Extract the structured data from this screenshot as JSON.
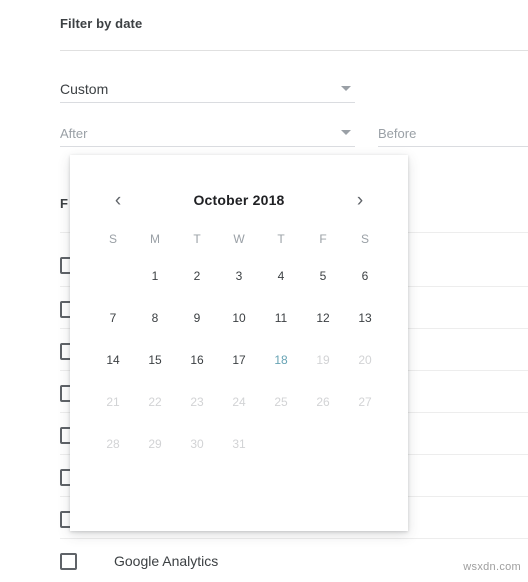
{
  "panel": {
    "section_title": "Filter by date",
    "range_field": {
      "label": "Custom",
      "caret_icon": "chevron-down-icon"
    },
    "after_field": {
      "placeholder": "After",
      "value": "",
      "caret_icon": "chevron-down-icon"
    },
    "before_field": {
      "placeholder": "Before",
      "value": ""
    },
    "obscured_label": "F",
    "checkbox_rows": [
      {
        "label": "",
        "checked": false
      },
      {
        "label": "",
        "checked": false
      },
      {
        "label": "",
        "checked": false
      },
      {
        "label": "",
        "checked": false
      },
      {
        "label": "",
        "checked": false
      },
      {
        "label": "Google Analytics",
        "checked": false
      }
    ]
  },
  "calendar": {
    "prev_icon": "‹",
    "next_icon": "›",
    "prev_label": "previous-month",
    "next_label": "next-month",
    "title": "October 2018",
    "month": "October",
    "year": "2018",
    "day_initials": [
      "S",
      "M",
      "T",
      "W",
      "T",
      "F",
      "S"
    ],
    "today": 18,
    "first_day_column": 1,
    "days_in_month": 31,
    "enabled_through": 18,
    "accent_today": "#67a3b4",
    "weeks": [
      [
        {
          "n": "",
          "state": "empty"
        },
        {
          "n": "1",
          "state": "enabled"
        },
        {
          "n": "2",
          "state": "enabled"
        },
        {
          "n": "3",
          "state": "enabled"
        },
        {
          "n": "4",
          "state": "enabled"
        },
        {
          "n": "5",
          "state": "enabled"
        },
        {
          "n": "6",
          "state": "enabled"
        }
      ],
      [
        {
          "n": "7",
          "state": "enabled"
        },
        {
          "n": "8",
          "state": "enabled"
        },
        {
          "n": "9",
          "state": "enabled"
        },
        {
          "n": "10",
          "state": "enabled"
        },
        {
          "n": "11",
          "state": "enabled"
        },
        {
          "n": "12",
          "state": "enabled"
        },
        {
          "n": "13",
          "state": "enabled"
        }
      ],
      [
        {
          "n": "14",
          "state": "enabled"
        },
        {
          "n": "15",
          "state": "enabled"
        },
        {
          "n": "16",
          "state": "enabled"
        },
        {
          "n": "17",
          "state": "enabled"
        },
        {
          "n": "18",
          "state": "today"
        },
        {
          "n": "19",
          "state": "disabled"
        },
        {
          "n": "20",
          "state": "disabled"
        }
      ],
      [
        {
          "n": "21",
          "state": "disabled"
        },
        {
          "n": "22",
          "state": "disabled"
        },
        {
          "n": "23",
          "state": "disabled"
        },
        {
          "n": "24",
          "state": "disabled"
        },
        {
          "n": "25",
          "state": "disabled"
        },
        {
          "n": "26",
          "state": "disabled"
        },
        {
          "n": "27",
          "state": "disabled"
        }
      ],
      [
        {
          "n": "28",
          "state": "disabled"
        },
        {
          "n": "29",
          "state": "disabled"
        },
        {
          "n": "30",
          "state": "disabled"
        },
        {
          "n": "31",
          "state": "disabled"
        },
        {
          "n": "",
          "state": "empty"
        },
        {
          "n": "",
          "state": "empty"
        },
        {
          "n": "",
          "state": "empty"
        }
      ]
    ]
  },
  "watermark": "wsxdn.com"
}
